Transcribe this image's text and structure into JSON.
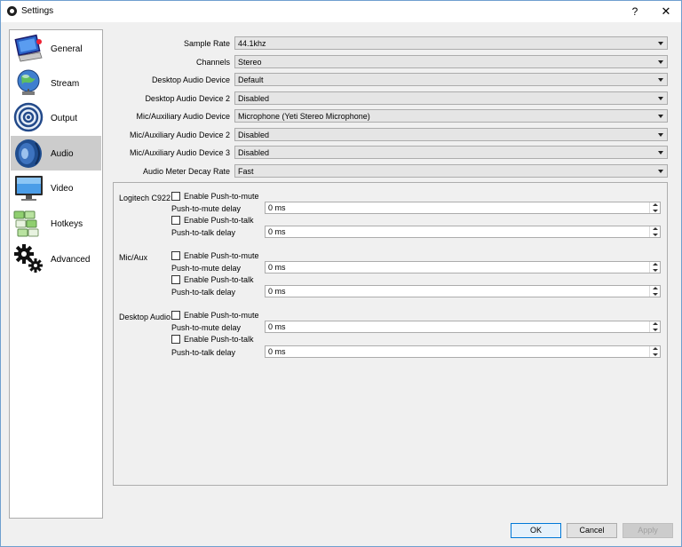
{
  "window": {
    "title": "Settings",
    "help_glyph": "?",
    "close_glyph": "✕"
  },
  "sidebar": {
    "items": [
      {
        "label": "General",
        "icon": "monitor-icon"
      },
      {
        "label": "Stream",
        "icon": "globe-icon"
      },
      {
        "label": "Output",
        "icon": "broadcast-icon"
      },
      {
        "label": "Audio",
        "icon": "speaker-icon",
        "selected": true
      },
      {
        "label": "Video",
        "icon": "display-icon"
      },
      {
        "label": "Hotkeys",
        "icon": "keyboard-icon"
      },
      {
        "label": "Advanced",
        "icon": "gears-icon"
      }
    ]
  },
  "audio": {
    "fields": [
      {
        "label": "Sample Rate",
        "value": "44.1khz"
      },
      {
        "label": "Channels",
        "value": "Stereo"
      },
      {
        "label": "Desktop Audio Device",
        "value": "Default"
      },
      {
        "label": "Desktop Audio Device 2",
        "value": "Disabled"
      },
      {
        "label": "Mic/Auxiliary Audio Device",
        "value": "Microphone (Yeti Stereo Microphone)"
      },
      {
        "label": "Mic/Auxiliary Audio Device 2",
        "value": "Disabled"
      },
      {
        "label": "Mic/Auxiliary Audio Device 3",
        "value": "Disabled"
      },
      {
        "label": "Audio Meter Decay Rate",
        "value": "Fast"
      }
    ],
    "devices": [
      {
        "name": "Logitech C922",
        "push_to_mute_label": "Enable Push-to-mute",
        "push_to_mute_checked": false,
        "push_to_mute_delay_label": "Push-to-mute delay",
        "push_to_mute_delay": "0 ms",
        "push_to_talk_label": "Enable Push-to-talk",
        "push_to_talk_checked": false,
        "push_to_talk_delay_label": "Push-to-talk delay",
        "push_to_talk_delay": "0 ms"
      },
      {
        "name": "Mic/Aux",
        "push_to_mute_label": "Enable Push-to-mute",
        "push_to_mute_checked": false,
        "push_to_mute_delay_label": "Push-to-mute delay",
        "push_to_mute_delay": "0 ms",
        "push_to_talk_label": "Enable Push-to-talk",
        "push_to_talk_checked": false,
        "push_to_talk_delay_label": "Push-to-talk delay",
        "push_to_talk_delay": "0 ms"
      },
      {
        "name": "Desktop Audio",
        "push_to_mute_label": "Enable Push-to-mute",
        "push_to_mute_checked": false,
        "push_to_mute_delay_label": "Push-to-mute delay",
        "push_to_mute_delay": "0 ms",
        "push_to_talk_label": "Enable Push-to-talk",
        "push_to_talk_checked": false,
        "push_to_talk_delay_label": "Push-to-talk delay",
        "push_to_talk_delay": "0 ms"
      }
    ]
  },
  "buttons": {
    "ok": "OK",
    "cancel": "Cancel",
    "apply": "Apply"
  },
  "colors": {
    "selected_nav": "#cccccc",
    "ok_border": "#0078d7",
    "window_bg": "#f0f0f0"
  }
}
